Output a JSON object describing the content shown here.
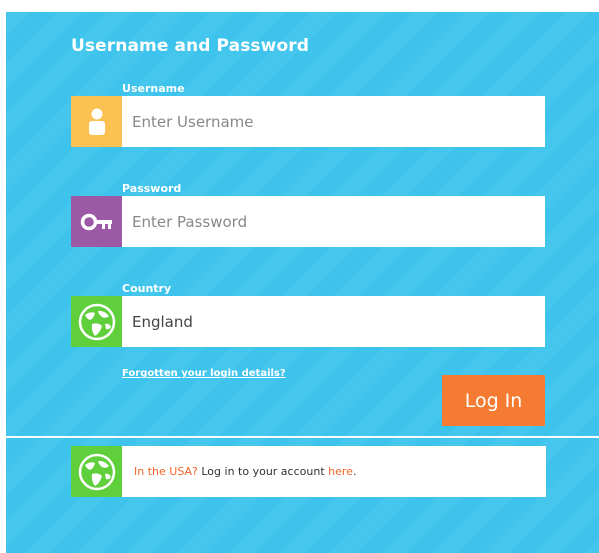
{
  "form": {
    "title": "Username and Password",
    "username": {
      "label": "Username",
      "placeholder": "Enter Username",
      "icon": "user-icon",
      "color": "#fcc153"
    },
    "password": {
      "label": "Password",
      "placeholder": "Enter Password",
      "icon": "key-icon",
      "color": "#9b59a6"
    },
    "country": {
      "label": "Country",
      "value": "England",
      "icon": "globe-icon",
      "color": "#5fcf3b"
    },
    "forgot_link": "Forgotten your login details?",
    "login_button": "Log In"
  },
  "usa": {
    "icon": "globe-icon",
    "prefix": "In the USA?",
    "middle": " Log in to your account ",
    "link": "here",
    "suffix": "."
  },
  "colors": {
    "panel_bg": "#3ec4ec",
    "accent_orange": "#f47b31"
  }
}
